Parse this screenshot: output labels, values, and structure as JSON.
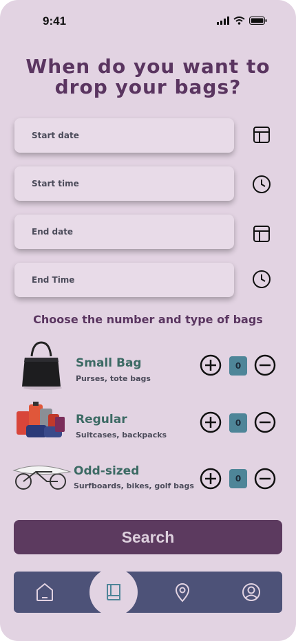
{
  "status_bar": {
    "time": "9:41"
  },
  "title": {
    "line1": "When do you want to",
    "line2": "drop your bags?"
  },
  "fields": [
    {
      "label": "Start date",
      "icon": "calendar-icon"
    },
    {
      "label": "Start time",
      "icon": "clock-icon"
    },
    {
      "label": "End date",
      "icon": "calendar-icon"
    },
    {
      "label": "End Time",
      "icon": "clock-icon"
    }
  ],
  "bags_heading": "Choose the number and type of bags",
  "bags": [
    {
      "name": "Small Bag",
      "description": "Purses, tote bags",
      "count": "0"
    },
    {
      "name": "Regular",
      "description": "Suitcases, backpacks",
      "count": "0"
    },
    {
      "name": "Odd-sized",
      "description": "Surfboards, bikes, golf bags",
      "count": "0"
    }
  ],
  "search_label": "Search",
  "nav": {
    "items": [
      "home-icon",
      "booking-icon",
      "location-icon",
      "profile-icon"
    ],
    "active": "booking-icon"
  },
  "colors": {
    "accent": "#5c3a5f",
    "background": "#e2d3e2",
    "nav": "#4d5278",
    "count": "#4e8598"
  }
}
